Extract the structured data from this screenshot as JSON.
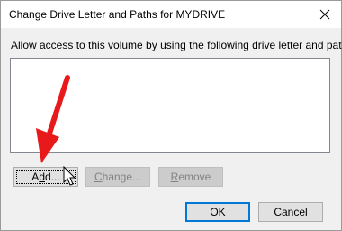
{
  "window": {
    "title": "Change Drive Letter and Paths for MYDRIVE",
    "close_glyph": "✕"
  },
  "prompt": "Allow access to this volume by using the following drive letter and paths:",
  "paths_list": [],
  "buttons": {
    "add": {
      "label": "Add...",
      "mnemonic": "d"
    },
    "change": {
      "label": "Change...",
      "mnemonic": "C",
      "disabled": true
    },
    "remove": {
      "label": "Remove",
      "mnemonic": "R",
      "disabled": true
    },
    "ok": {
      "label": "OK"
    },
    "cancel": {
      "label": "Cancel"
    }
  },
  "colors": {
    "annotation_arrow": "#e8191b",
    "default_button_border": "#0078d7",
    "dialog_background": "#f0f0f0"
  },
  "icons": {
    "close": "close-icon",
    "cursor": "mouse-pointer-icon",
    "annotation": "red-arrow-annotation"
  }
}
